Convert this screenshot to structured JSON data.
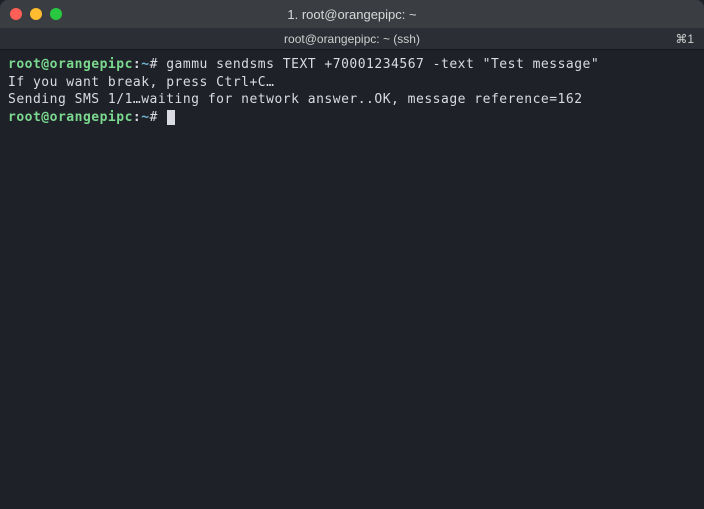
{
  "window": {
    "title": "1. root@orangepipc: ~"
  },
  "tab": {
    "label": "root@orangepipc: ~ (ssh)",
    "index": "⌘1"
  },
  "prompt": {
    "user_host": "root@orangepipc",
    "colon": ":",
    "path": "~",
    "symbol": "#"
  },
  "lines": {
    "cmd1": "gammu sendsms TEXT +70001234567 -text \"Test message\"",
    "out1": "If you want break, press Ctrl+C…",
    "out2": "Sending SMS 1/1…waiting for network answer..OK, message reference=162"
  }
}
